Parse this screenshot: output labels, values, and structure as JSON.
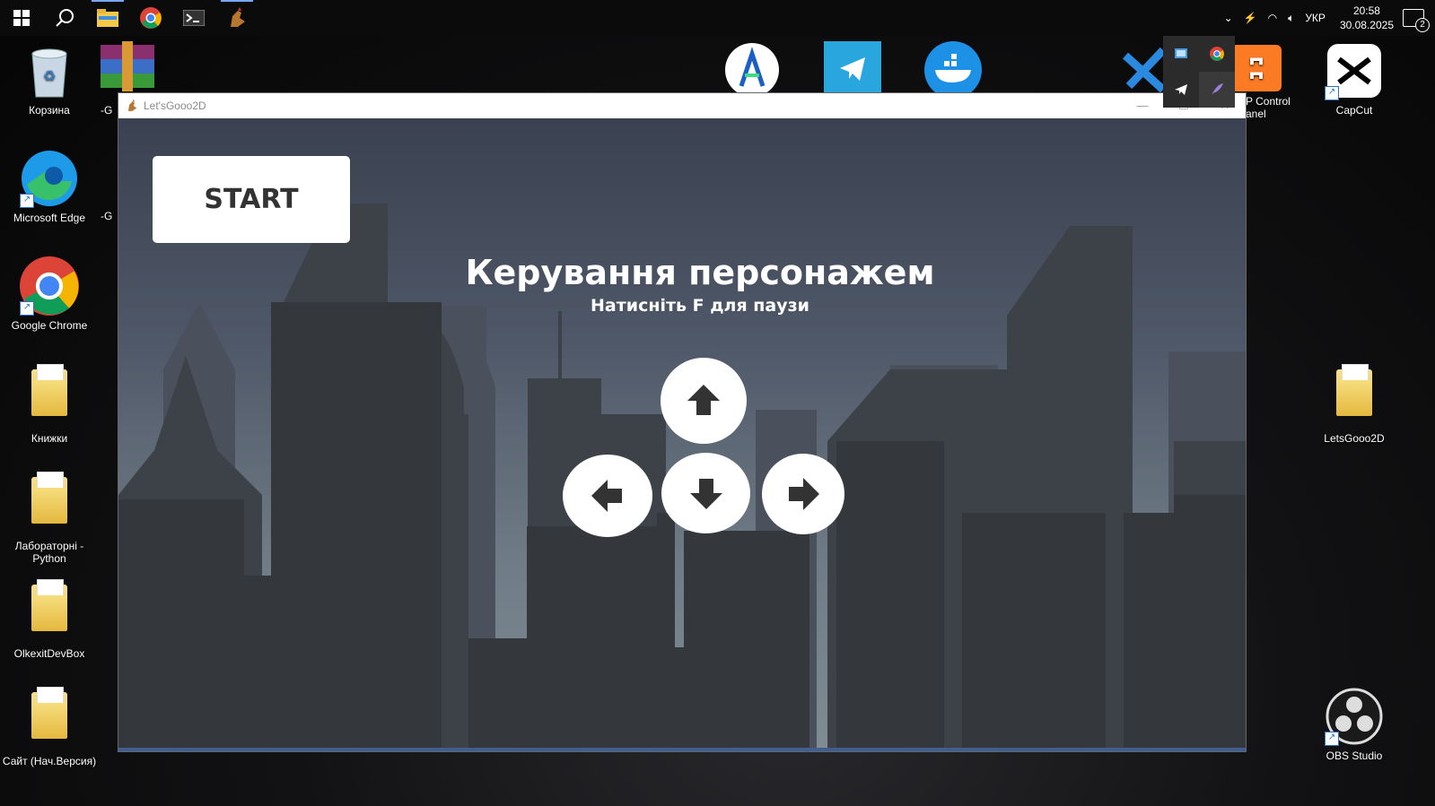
{
  "taskbar": {
    "apps": [
      {
        "name": "start",
        "icon": "windows-icon"
      },
      {
        "name": "search",
        "icon": "search-icon"
      },
      {
        "name": "file-explorer",
        "icon": "folder-icon",
        "active": true
      },
      {
        "name": "chrome",
        "icon": "chrome-icon"
      },
      {
        "name": "terminal",
        "icon": "terminal-icon"
      },
      {
        "name": "letsgooo2d",
        "icon": "rooster-icon",
        "active": true
      }
    ],
    "tray": {
      "language": "УКР",
      "time": "20:58",
      "date": "30.08.2025",
      "notifications": "2"
    }
  },
  "desktop": {
    "icons": [
      {
        "label": "Корзина",
        "icon": "recycle-bin-icon"
      },
      {
        "label": "Microsoft Edge",
        "icon": "edge-icon"
      },
      {
        "label": "Google Chrome",
        "icon": "chrome-icon"
      },
      {
        "label": "Книжки",
        "icon": "folder-icon"
      },
      {
        "label": "Лабораторні - Python",
        "icon": "folder-icon"
      },
      {
        "label": "OlkexitDevBox",
        "icon": "folder-icon"
      },
      {
        "label": "Сайт (Нач.Версия)",
        "icon": "folder-icon"
      },
      {
        "label": "LetsGooo2D",
        "icon": "folder-icon"
      },
      {
        "label": "CapCut",
        "icon": "capcut-icon"
      },
      {
        "label": "OBS Studio",
        "icon": "obs-icon"
      },
      {
        "label": "P Control\nanel",
        "icon": "xampp-icon"
      }
    ],
    "partial_labels": [
      "-G",
      "-G"
    ]
  },
  "window": {
    "title": "Let'sGooo2D",
    "controls": {
      "minimize": "—",
      "maximize": "☐",
      "close": "✕"
    }
  },
  "game": {
    "start_label": "START",
    "title": "Керування персонажем",
    "subtitle": "Натисніть F для паузи",
    "arrows": [
      "up",
      "left",
      "down",
      "right"
    ]
  }
}
